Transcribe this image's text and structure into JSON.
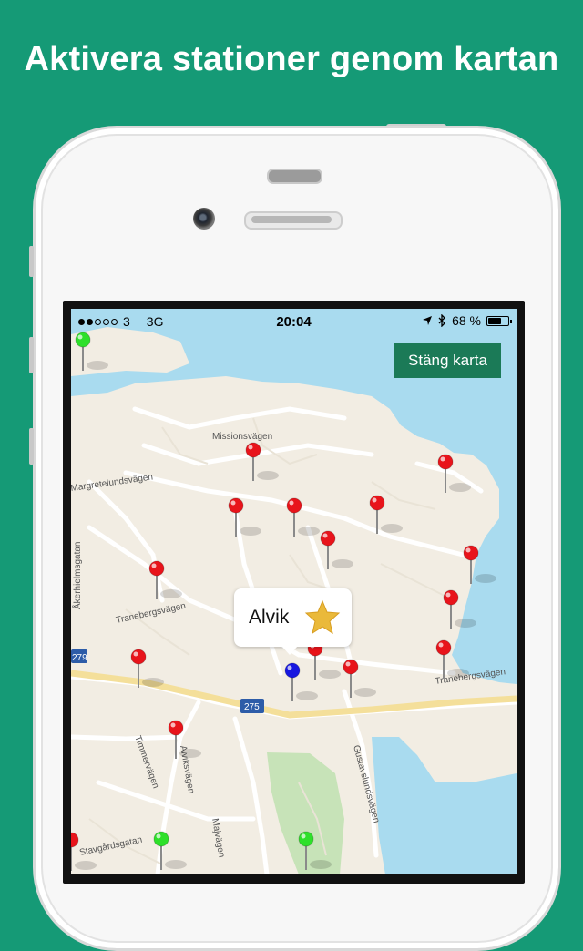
{
  "headline": "Aktivera stationer genom kartan",
  "status_bar": {
    "carrier": "3",
    "network": "3G",
    "time": "20:04",
    "battery_text": "68 %",
    "battery_level": 0.68
  },
  "close_map_button": "Stäng karta",
  "callout": {
    "station_name": "Alvik",
    "favorite_icon": "star-icon"
  },
  "map": {
    "street_labels": [
      "Missionsvägen",
      "Margretelundsvägen",
      "Åkerhielmsgatan",
      "Tranebergsvägen",
      "Tranebergsvägen",
      "Timmervägen",
      "Alviksvägen",
      "Stavgårdsgatan",
      "Gustavslundsvägen",
      "Majvägen"
    ],
    "road_shields": [
      "279",
      "275"
    ]
  },
  "colors": {
    "brand_green": "#159a76",
    "button_green": "#1b7a57",
    "pin_red": "#e8141b",
    "pin_green": "#2ee02a",
    "pin_blue": "#1717e0",
    "water": "#a9dbef",
    "land": "#f2ede3"
  }
}
